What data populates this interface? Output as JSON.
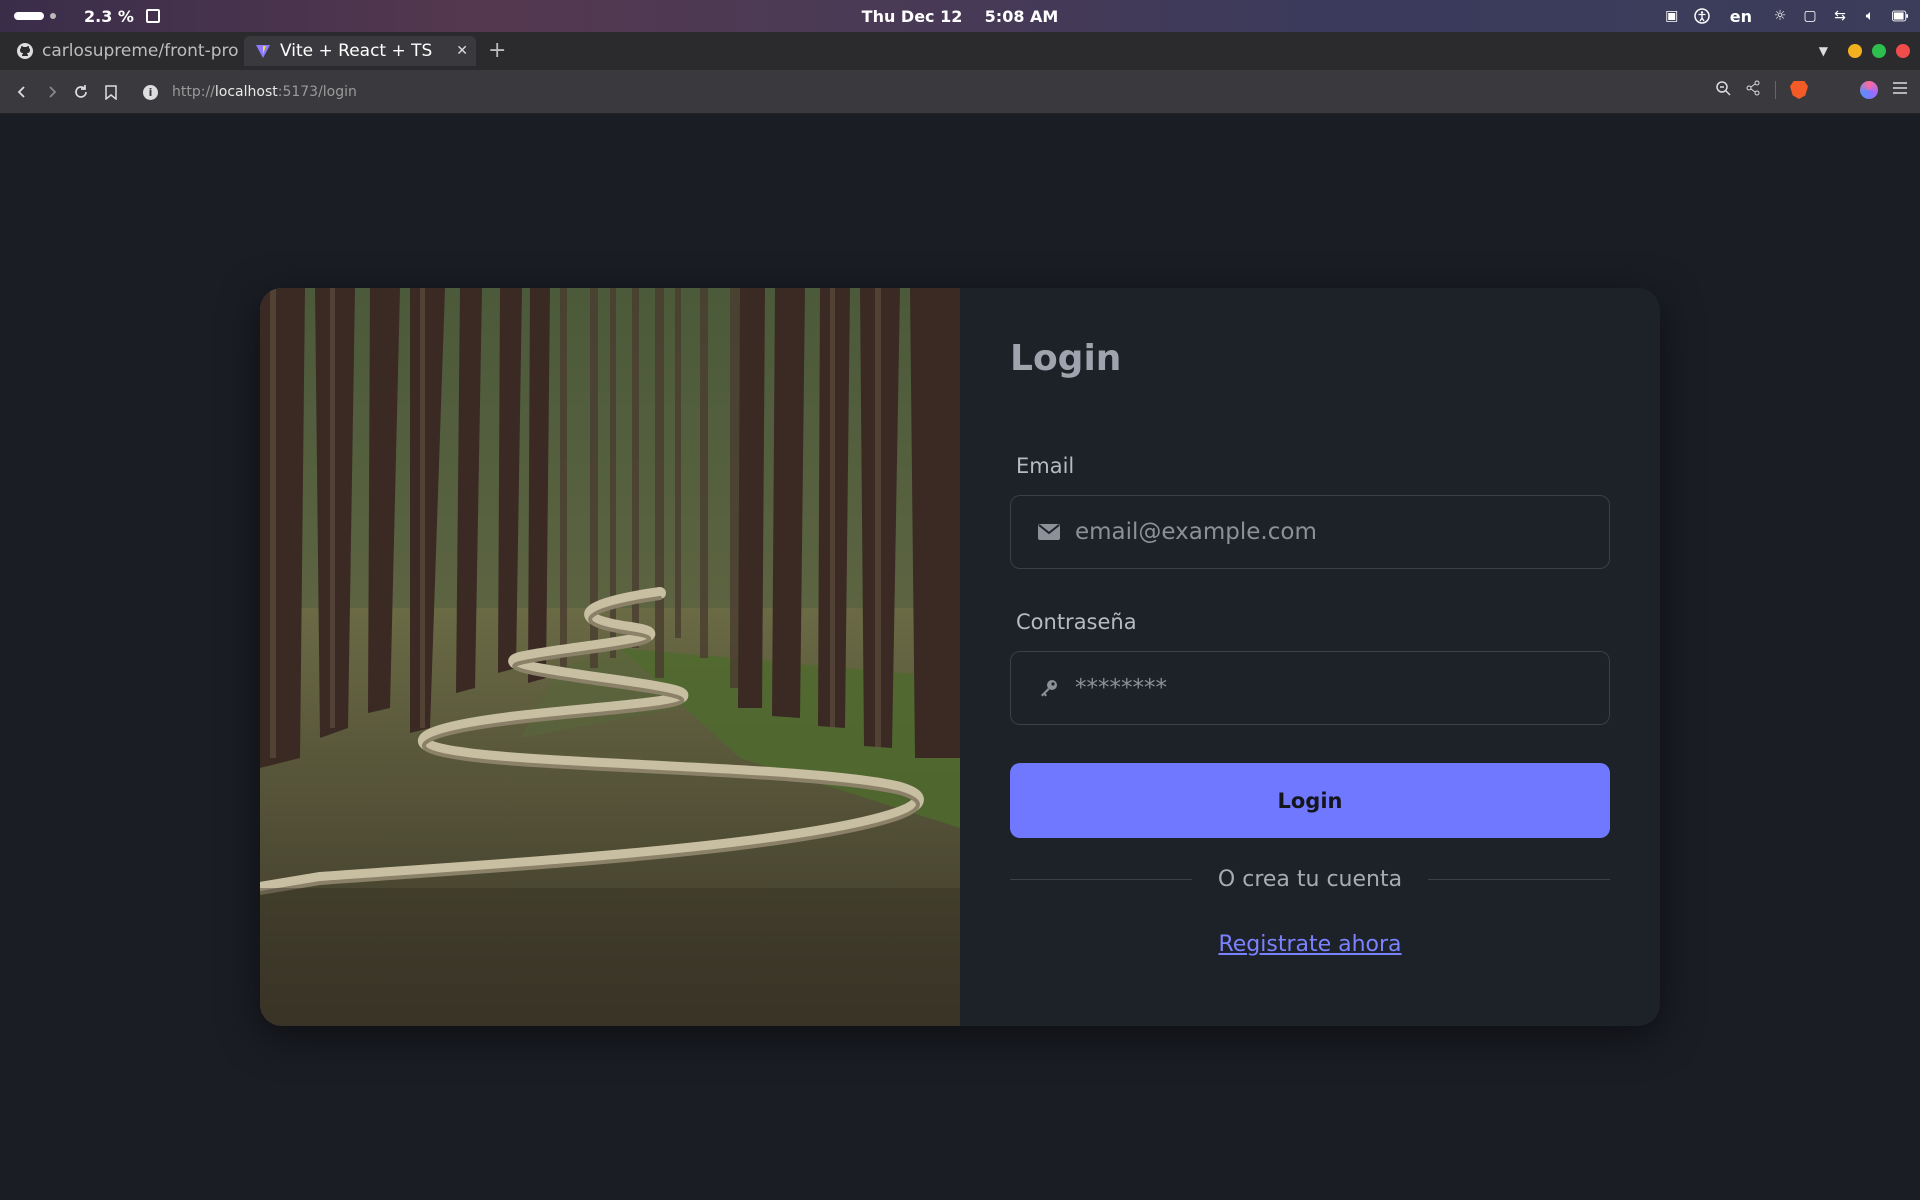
{
  "system_bar": {
    "cpu_percent": "2.3 %",
    "date": "Thu Dec 12",
    "time": "5:08 AM",
    "language": "en"
  },
  "browser": {
    "tabs": [
      {
        "title": "carlosupreme/front-pro",
        "active": false
      },
      {
        "title": "Vite + React + TS",
        "active": true
      }
    ],
    "url_scheme": "http://",
    "url_host": "localhost",
    "url_rest": ":5173/login"
  },
  "login": {
    "title": "Login",
    "email_label": "Email",
    "email_placeholder": "email@example.com",
    "password_label": "Contraseña",
    "password_placeholder": "********",
    "submit_label": "Login",
    "divider_text": "O crea tu cuenta",
    "register_link": "Registrate ahora"
  },
  "colors": {
    "accent": "#7078ff",
    "background": "#1a1d24",
    "card": "#1d2128"
  }
}
